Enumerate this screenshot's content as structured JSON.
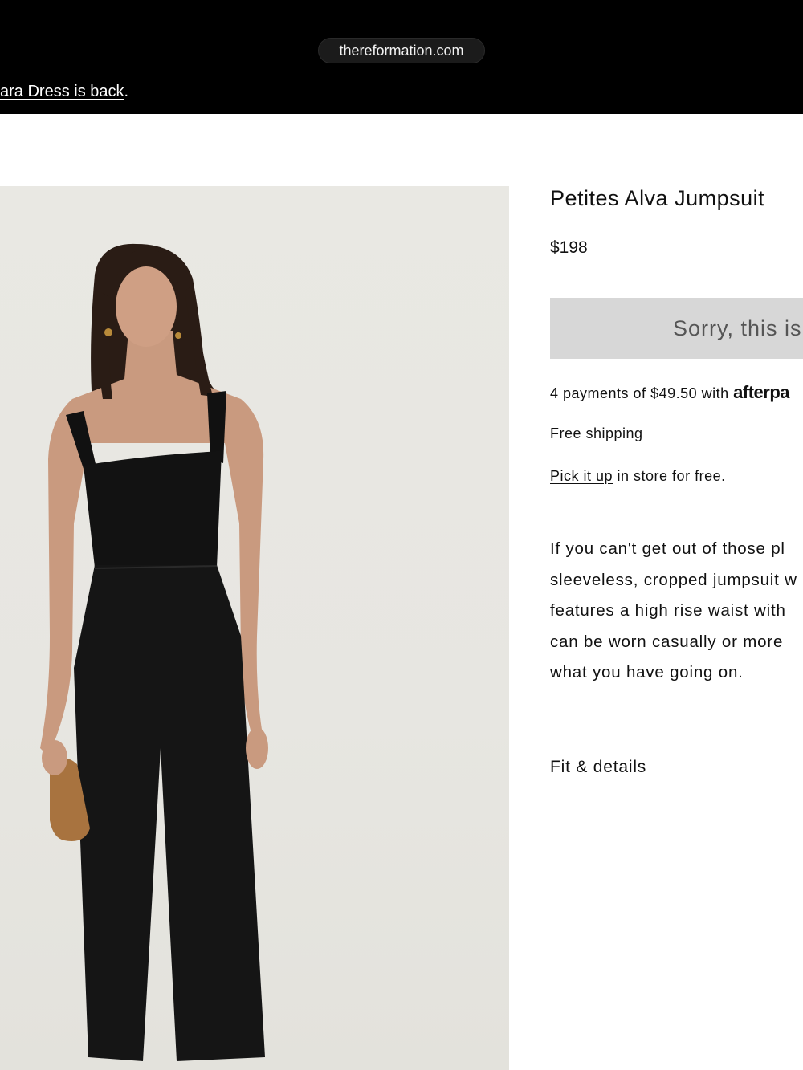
{
  "browser": {
    "url": "thereformation.com"
  },
  "promo": {
    "link_text": "ara Dress is back",
    "suffix": "."
  },
  "product": {
    "image_alt": "Model wearing black sleeveless cropped jumpsuit holding a tan clutch",
    "title": "Petites Alva Jumpsuit",
    "price": "$198",
    "soldout_label": "Sorry, this is",
    "afterpay_text": "4 payments of $49.50 with ",
    "afterpay_brand": "afterpa",
    "shipping": "Free shipping",
    "pickup_link": "Pick it up",
    "pickup_rest": " in store for free.",
    "description_lines": [
      "If you can't get out of those pl",
      "sleeveless, cropped jumpsuit w",
      "features a high rise waist with",
      "can be worn casually or more",
      "what you have going on."
    ],
    "fit_details": "Fit & details"
  },
  "colors": {
    "header_bg": "#000000",
    "soldout_bg": "#d7d7d7",
    "photo_bg": "#e8e7e2",
    "garment": "#111111",
    "clutch": "#a8733f"
  }
}
